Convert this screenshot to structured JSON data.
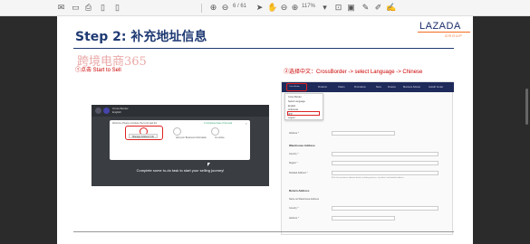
{
  "viewer": {
    "page_label": "/ 61",
    "page_current": "6",
    "zoom": "117%"
  },
  "slide": {
    "title": "Step 2: 补充地址信息",
    "logo": "LAZADA",
    "logo_sub": "GROUP",
    "watermark": "跨境电商365",
    "step1": "①点击 Start to Sell",
    "step2": "②选择中文：CrossBorder -> select Language -> Chinese"
  },
  "shot1": {
    "user_name": "Cross Border",
    "user_sub": "English",
    "modal_title": "Welcome Please complete the to-do task list",
    "modal_status": "0 completed task of the task",
    "task1": "Start to sell",
    "task2": "Add your Business Information",
    "task3": "Go online",
    "task1_button": "Manage Address Info",
    "banner": "Complete some to-do task to start your selling journey!"
  },
  "shot2": {
    "nav_user": "Cross Border",
    "nav_items": [
      "Products",
      "Orders",
      "Promotions",
      "Store",
      "Finance",
      "Business Advisor",
      "Growth Center"
    ],
    "dropdown_title": "Cross Border",
    "dropdown_label": "Select Language",
    "dropdown_option1": "English",
    "dropdown_option2": "中文",
    "dropdown_option3": "Indonesia",
    "dropdown_option4": "Logout",
    "section1": "Warehouse Address",
    "label_country": "Country *",
    "label_address": "Address *",
    "label_region": "Region *",
    "label_address2": "Address 1 *",
    "label_detailed": "Detailed Address *",
    "hint": "Fill in the warehouse address details, including province, city, district and detailed address",
    "section2": "Return Address",
    "label_same": "Same as Warehouse Address",
    "label_country2": "Country *",
    "label_address3": "Address *"
  }
}
